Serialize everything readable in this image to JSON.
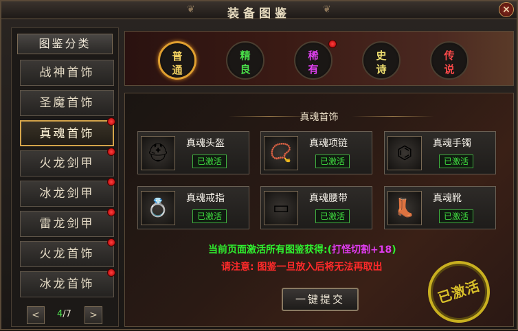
{
  "window": {
    "title": "装备图鉴",
    "close_icon": "×"
  },
  "sidebar": {
    "header": "图鉴分类",
    "items": [
      {
        "label": "战神首饰",
        "badge": false,
        "active": false
      },
      {
        "label": "圣魔首饰",
        "badge": false,
        "active": false
      },
      {
        "label": "真魂首饰",
        "badge": true,
        "active": true
      },
      {
        "label": "火龙剑甲",
        "badge": true,
        "active": false
      },
      {
        "label": "冰龙剑甲",
        "badge": true,
        "active": false
      },
      {
        "label": "雷龙剑甲",
        "badge": true,
        "active": false
      },
      {
        "label": "火龙首饰",
        "badge": true,
        "active": false
      },
      {
        "label": "冰龙首饰",
        "badge": true,
        "active": false
      }
    ],
    "pager": {
      "prev": "<",
      "next": ">",
      "current": "4",
      "total": "/7"
    }
  },
  "tiers": [
    {
      "c1": "普",
      "c2": "通",
      "color": "#f0d060",
      "active": true,
      "badge": false
    },
    {
      "c1": "精",
      "c2": "良",
      "color": "#4adf4a",
      "active": false,
      "badge": false
    },
    {
      "c1": "稀",
      "c2": "有",
      "color": "#e040f0",
      "active": false,
      "badge": true
    },
    {
      "c1": "史",
      "c2": "诗",
      "color": "#f0e070",
      "active": false,
      "badge": false
    },
    {
      "c1": "传",
      "c2": "说",
      "color": "#ff4a4a",
      "active": false,
      "badge": false
    }
  ],
  "main": {
    "section_title": "真魂首饰",
    "cards": [
      {
        "name": "真魂头盔",
        "status": "已激活",
        "icon": "helmet-icon",
        "glyph": "⛑"
      },
      {
        "name": "真魂项链",
        "status": "已激活",
        "icon": "necklace-icon",
        "glyph": "📿"
      },
      {
        "name": "真魂手镯",
        "status": "已激活",
        "icon": "bracelet-icon",
        "glyph": "⌬"
      },
      {
        "name": "真魂戒指",
        "status": "已激活",
        "icon": "ring-icon",
        "glyph": "💍"
      },
      {
        "name": "真魂腰带",
        "status": "已激活",
        "icon": "belt-icon",
        "glyph": "▭"
      },
      {
        "name": "真魂靴",
        "status": "已激活",
        "icon": "boots-icon",
        "glyph": "👢"
      }
    ],
    "reward_prefix": "当前页面激活所有图鉴获得:(",
    "reward_value": "打怪切割+18",
    "reward_suffix": ")",
    "warning": "请注意: 图鉴一旦放入后将无法再取出",
    "submit_label": "一键提交",
    "stamp": "已激活"
  }
}
